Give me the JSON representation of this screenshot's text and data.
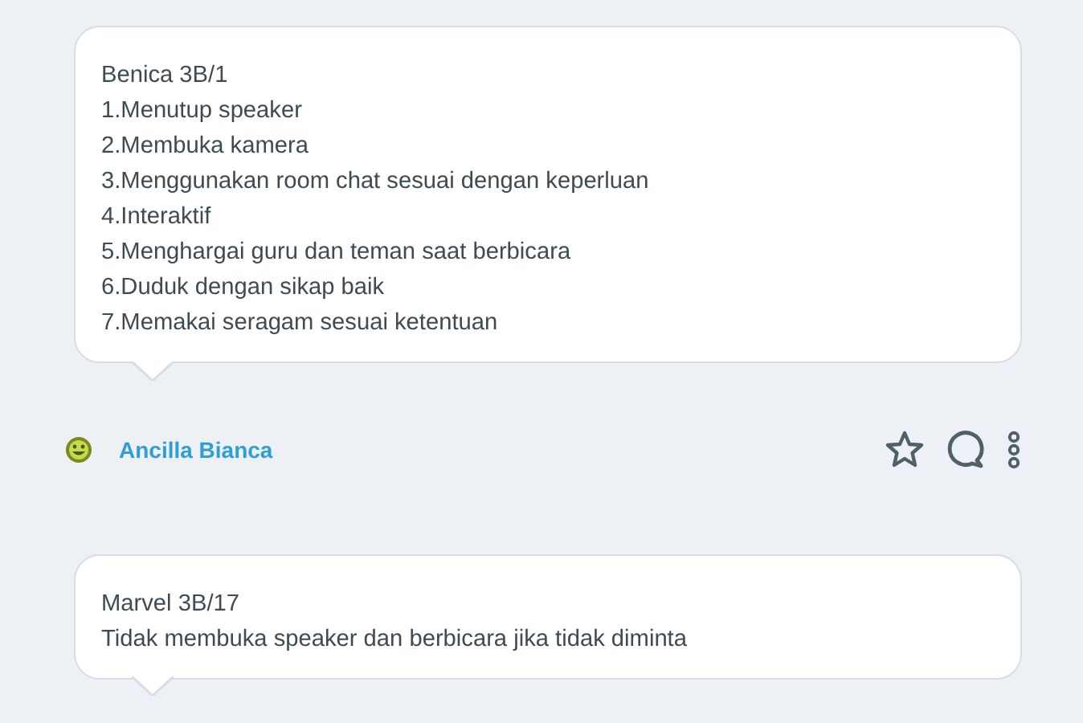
{
  "posts": [
    {
      "lines": [
        "Benica 3B/1",
        "1.Menutup speaker",
        "2.Membuka kamera",
        "3.Menggunakan room chat sesuai dengan keperluan",
        "4.Interaktif",
        "5.Menghargai guru dan teman saat berbicara",
        "6.Duduk dengan sikap baik",
        "7.Memakai seragam sesuai ketentuan"
      ],
      "author": {
        "name": "Ancilla Bianca"
      }
    },
    {
      "lines": [
        "Marvel 3B/17",
        "Tidak membuka speaker dan berbicara jika tidak diminta"
      ]
    }
  ]
}
